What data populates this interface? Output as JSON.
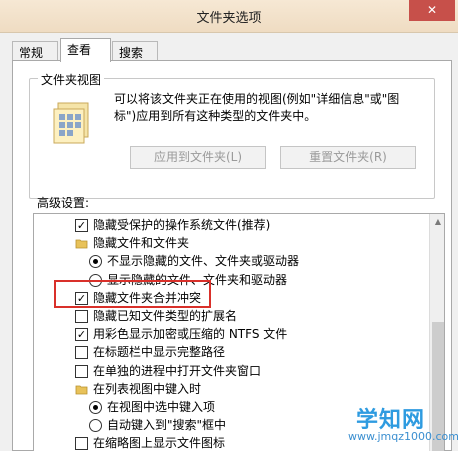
{
  "window": {
    "title": "文件夹选项",
    "close_glyph": "✕"
  },
  "tabs": [
    {
      "label": "常规",
      "active": false
    },
    {
      "label": "查看",
      "active": true
    },
    {
      "label": "搜索",
      "active": false
    }
  ],
  "folder_view": {
    "legend": "文件夹视图",
    "description": "可以将该文件夹正在使用的视图(例如\"详细信息\"或\"图标\")应用到所有这种类型的文件夹中。",
    "apply_button": "应用到文件夹(L)",
    "reset_button": "重置文件夹(R)"
  },
  "advanced": {
    "label": "高级设置:",
    "items": [
      {
        "kind": "checkbox",
        "checked": true,
        "indent": 0,
        "label": "隐藏受保护的操作系统文件(推荐)"
      },
      {
        "kind": "folder",
        "indent": 0,
        "label": "隐藏文件和文件夹"
      },
      {
        "kind": "radio",
        "selected": true,
        "indent": 1,
        "label": "不显示隐藏的文件、文件夹或驱动器"
      },
      {
        "kind": "radio",
        "selected": false,
        "indent": 1,
        "label": "显示隐藏的文件、文件夹和驱动器"
      },
      {
        "kind": "checkbox",
        "checked": true,
        "indent": 0,
        "label": "隐藏文件夹合并冲突"
      },
      {
        "kind": "checkbox",
        "checked": false,
        "indent": 0,
        "label": "隐藏已知文件类型的扩展名"
      },
      {
        "kind": "checkbox",
        "checked": true,
        "indent": 0,
        "label": "用彩色显示加密或压缩的 NTFS 文件"
      },
      {
        "kind": "checkbox",
        "checked": false,
        "indent": 0,
        "label": "在标题栏中显示完整路径"
      },
      {
        "kind": "checkbox",
        "checked": false,
        "indent": 0,
        "label": "在单独的进程中打开文件夹窗口"
      },
      {
        "kind": "folder",
        "indent": 0,
        "label": "在列表视图中键入时"
      },
      {
        "kind": "radio",
        "selected": true,
        "indent": 1,
        "label": "在视图中选中键入项"
      },
      {
        "kind": "radio",
        "selected": false,
        "indent": 1,
        "label": "自动键入到\"搜索\"框中"
      },
      {
        "kind": "checkbox",
        "checked": false,
        "indent": 0,
        "label": "在缩略图上显示文件图标"
      }
    ]
  },
  "watermark": {
    "main": "学知网",
    "url": "www.jmqz1000.com"
  },
  "colors": {
    "highlight": "#d9302a",
    "titlebar": "#f3e3cc",
    "close": "#c7504a"
  }
}
